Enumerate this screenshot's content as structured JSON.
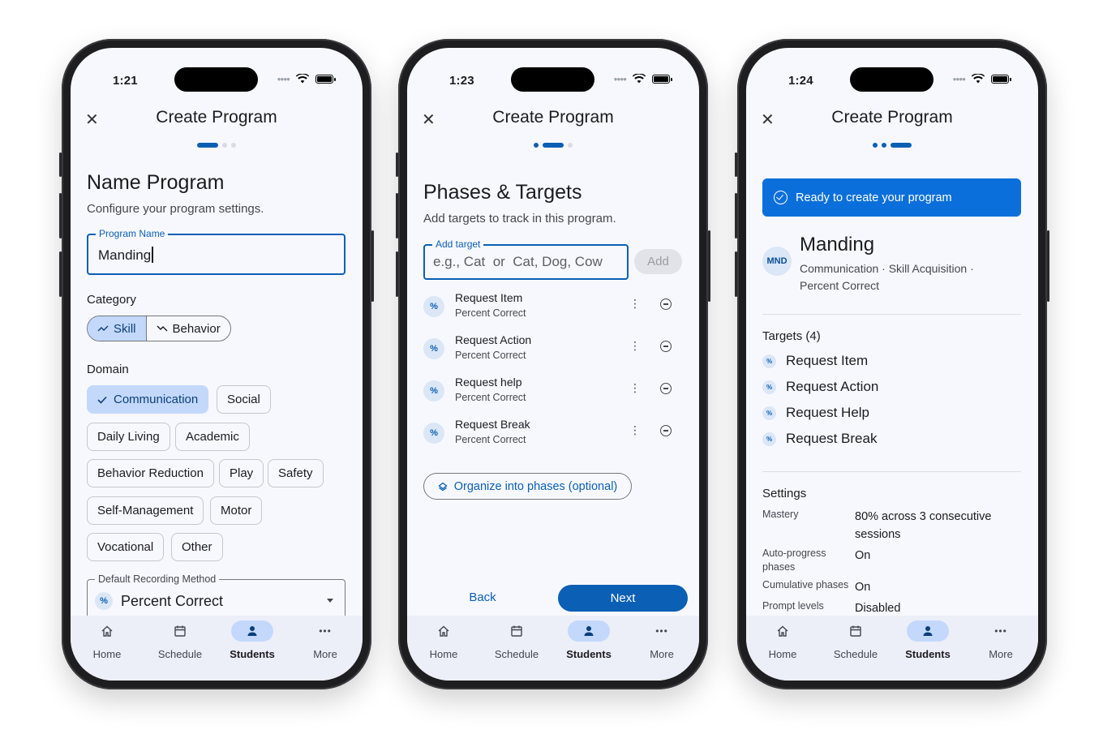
{
  "status_bar": {
    "times": [
      "1:21",
      "1:23",
      "1:24"
    ]
  },
  "header": {
    "title": "Create Program"
  },
  "nav": {
    "items": [
      "Home",
      "Schedule",
      "Students",
      "More"
    ],
    "active": "Students"
  },
  "colors": {
    "primary": "#0b5fb4",
    "chip_selected": "#c3d8fb",
    "banner": "#0b6fdb",
    "background": "#f7f8fe"
  },
  "step1": {
    "title": "Name Program",
    "subtitle": "Configure your program settings.",
    "program_name_label": "Program Name",
    "program_name_value": "Manding",
    "category_label": "Category",
    "category_options": [
      "Skill",
      "Behavior"
    ],
    "category_selected": "Skill",
    "domain_label": "Domain",
    "domains": [
      "Communication",
      "Social",
      "Daily Living",
      "Academic",
      "Behavior Reduction",
      "Play",
      "Safety",
      "Self-Management",
      "Motor",
      "Vocational",
      "Other"
    ],
    "domain_selected": "Communication",
    "recording_label": "Default Recording Method",
    "recording_value": "Percent Correct",
    "recording_icon": "%"
  },
  "step2": {
    "title": "Phases & Targets",
    "subtitle": "Add targets to track in this program.",
    "add_target_label": "Add target",
    "add_target_placeholder": "e.g., Cat  or  Cat, Dog, Cow",
    "add_button": "Add",
    "targets": [
      {
        "name": "Request Item",
        "method": "Percent Correct"
      },
      {
        "name": "Request Action",
        "method": "Percent Correct"
      },
      {
        "name": "Request help",
        "method": "Percent Correct"
      },
      {
        "name": "Request Break",
        "method": "Percent Correct"
      }
    ],
    "phases_button": "Organize into phases (optional)",
    "back": "Back",
    "next": "Next"
  },
  "step3": {
    "banner": "Ready to create your program",
    "avatar": "MND",
    "program_name": "Manding",
    "meta": "Communication · Skill Acquisition · Percent Correct",
    "targets_heading": "Targets (4)",
    "targets": [
      "Request Item",
      "Request Action",
      "Request Help",
      "Request Break"
    ],
    "settings_heading": "Settings",
    "settings": [
      {
        "key": "Mastery",
        "value": "80% across 3 consecutive sessions"
      },
      {
        "key": "Auto-progress phases",
        "value": "On"
      },
      {
        "key": "Cumulative phases",
        "value": "On"
      },
      {
        "key": "Prompt levels",
        "value": "Disabled"
      }
    ]
  }
}
